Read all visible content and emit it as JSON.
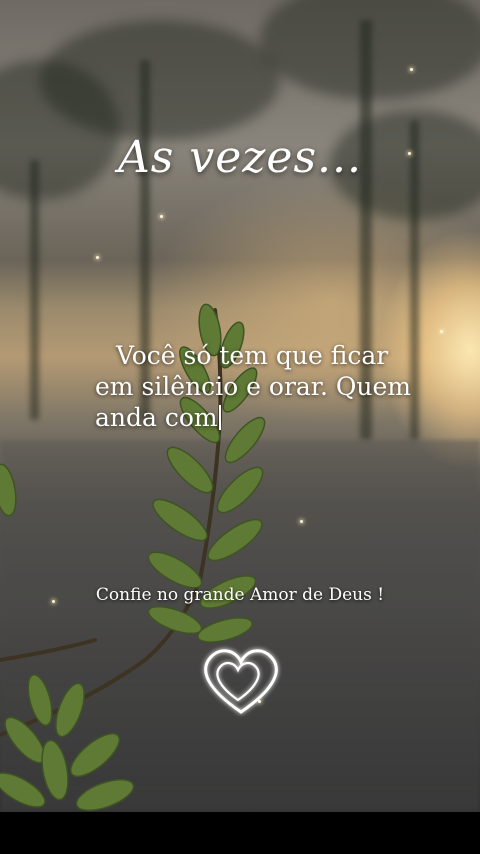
{
  "story": {
    "title": "As vezes...",
    "body_lines": [
      "Você só tem que ficar",
      "em silêncio e orar. Quem",
      "anda com"
    ],
    "caption": "Confie no grande Amor de Deus !"
  },
  "icons": {
    "hearts": "double-heart-outline-icon"
  },
  "colors": {
    "text": "#ffffff",
    "sun_glow": "#ffebb4",
    "background_dark": "#2e2e2e"
  }
}
